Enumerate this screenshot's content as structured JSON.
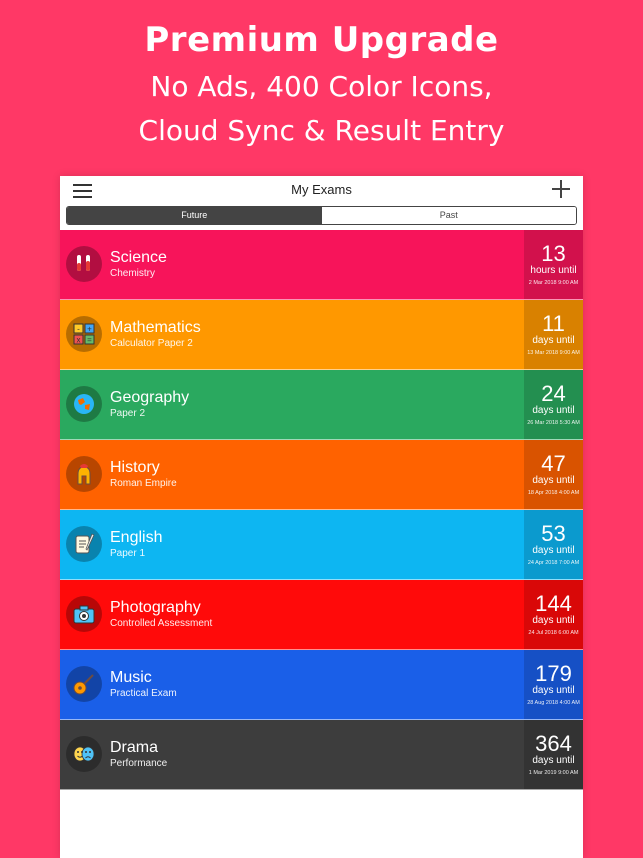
{
  "promo": {
    "title": "Premium Upgrade",
    "line1": "No Ads, 400 Color Icons,",
    "line2": "Cloud Sync & Result Entry"
  },
  "navbar": {
    "title": "My Exams",
    "menu_icon": "hamburger-icon",
    "add_icon": "plus-icon"
  },
  "segment": {
    "future": "Future",
    "past": "Past",
    "selected": "Future"
  },
  "exams": [
    {
      "subject": "Science",
      "paper": "Chemistry",
      "count": "13",
      "unit": "hours until",
      "date": "2 Mar 2018 9:00 AM",
      "color": "#f7145a",
      "icon": "flask-icon"
    },
    {
      "subject": "Mathematics",
      "paper": "Calculator Paper 2",
      "count": "11",
      "unit": "days until",
      "date": "13 Mar 2018 9:00 AM",
      "color": "#ff9800",
      "icon": "calculator-icon"
    },
    {
      "subject": "Geography",
      "paper": "Paper 2",
      "count": "24",
      "unit": "days until",
      "date": "26 Mar 2018 5:30 AM",
      "color": "#2aa95f",
      "icon": "globe-icon"
    },
    {
      "subject": "History",
      "paper": "Roman Empire",
      "count": "47",
      "unit": "days until",
      "date": "18 Apr 2018 4:00 AM",
      "color": "#ff6200",
      "icon": "roman-helmet-icon"
    },
    {
      "subject": "English",
      "paper": "Paper 1",
      "count": "53",
      "unit": "days until",
      "date": "24 Apr 2018 7:00 AM",
      "color": "#0db6f2",
      "icon": "scroll-quill-icon"
    },
    {
      "subject": "Photography",
      "paper": "Controlled Assessment",
      "count": "144",
      "unit": "days until",
      "date": "24 Jul 2018 6:00 AM",
      "color": "#ff0a0a",
      "icon": "camera-icon"
    },
    {
      "subject": "Music",
      "paper": "Practical Exam",
      "count": "179",
      "unit": "days until",
      "date": "28 Aug 2018 4:00 AM",
      "color": "#1a5fe8",
      "icon": "guitar-icon"
    },
    {
      "subject": "Drama",
      "paper": "Performance",
      "count": "364",
      "unit": "days until",
      "date": "1 Mar 2019 9:00 AM",
      "color": "#3d3d3d",
      "icon": "theatre-masks-icon"
    }
  ],
  "colors": {
    "background": "#ff3866",
    "segment_active": "#444444"
  }
}
